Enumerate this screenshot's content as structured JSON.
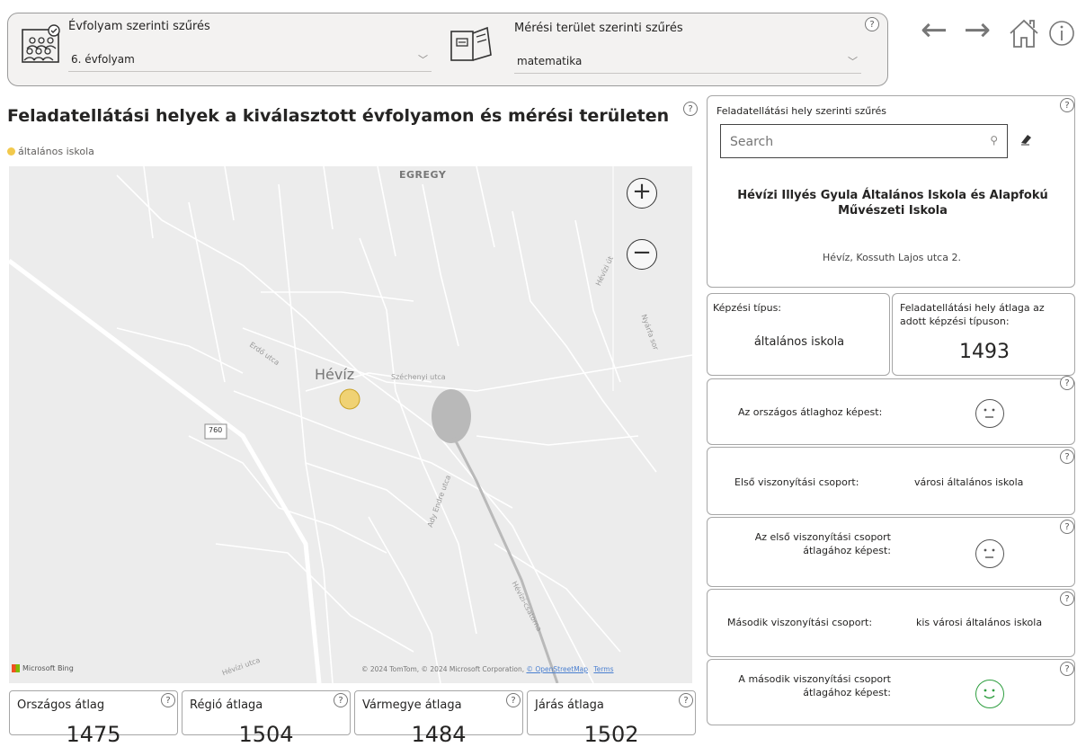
{
  "filters": {
    "grade_label": "Évfolyam szerinti szűrés",
    "grade_value": "6. évfolyam",
    "area_label": "Mérési terület szerinti szűrés",
    "area_value": "matematika",
    "help": "?"
  },
  "nav": {
    "back": "←",
    "forward": "→"
  },
  "map": {
    "title": "Feladatellátási helyek a kiválasztott évfolyamon és mérési területen",
    "legend": "általános iskola",
    "legend_color": "#f2c94c",
    "zoom_in": "+",
    "zoom_out": "−",
    "place_labels": [
      "EGREGY",
      "Hévíz",
      "Széchenyi utca",
      "Erdő utca",
      "Ady Endre utca",
      "Hévízi utca",
      "Hévízi-csatorna",
      "Hévízi út",
      "Nyárfa sor",
      "Hévízi út"
    ],
    "road_number": "760",
    "bing": "Microsoft Bing",
    "copyright": "© 2024 TomTom, © 2024 Microsoft Corporation,",
    "osm": "© OpenStreetMap",
    "terms": "Terms"
  },
  "right": {
    "filter_label": "Feladatellátási hely szerinti szűrés",
    "search_placeholder": "Search",
    "school_name": "Hévízi Illyés Gyula Általános Iskola és Alapfokú Művészeti Iskola",
    "address": "Hévíz, Kossuth Lajos utca 2.",
    "training_type_label": "Képzési típus:",
    "training_type_value": "általános iskola",
    "site_avg_label": "Feladatellátási hely átlaga az adott képzési típuson:",
    "site_avg_value": "1493",
    "national_compare_label": "Az országos átlaghoz képest:",
    "first_group_label": "Első viszonyítási csoport:",
    "first_group_value": "városi általános iskola",
    "first_group_compare_label": "Az első viszonyítási csoport átlagához képest:",
    "second_group_label": "Második viszonyítási csoport:",
    "second_group_value": "kis városi általános iskola",
    "second_group_compare_label": "A második viszonyítási csoport átlagához képest:",
    "colors": {
      "neutral": "#555555",
      "positive": "#2e9e3f"
    }
  },
  "stats": [
    {
      "label": "Országos átlag",
      "value": "1475"
    },
    {
      "label": "Régió átlaga",
      "value": "1504"
    },
    {
      "label": "Vármegye átlaga",
      "value": "1484"
    },
    {
      "label": "Járás átlaga",
      "value": "1502"
    }
  ]
}
